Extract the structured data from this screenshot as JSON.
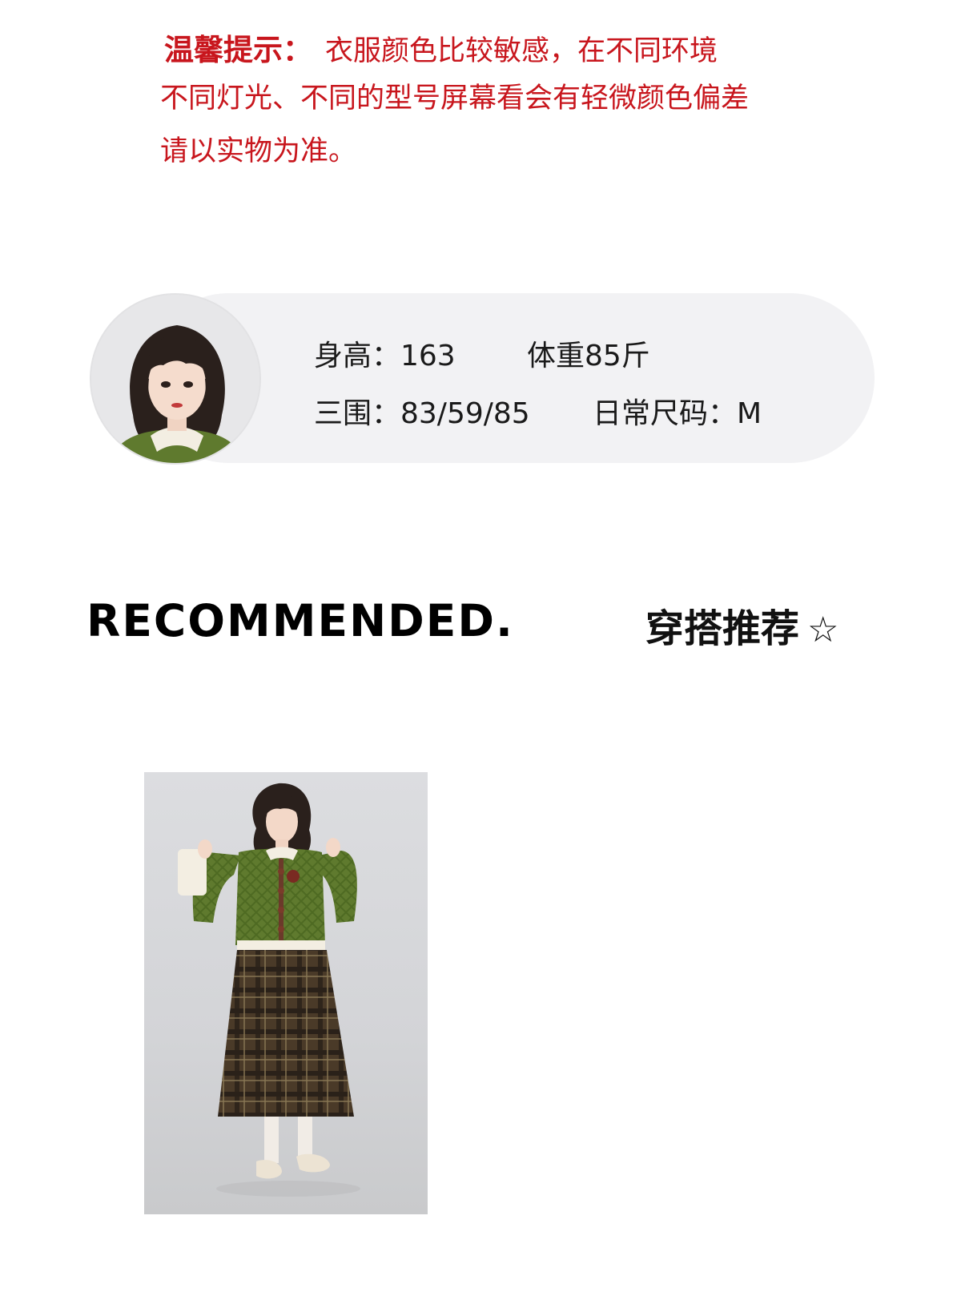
{
  "notice": {
    "label": "温馨提示：",
    "line1": "衣服颜色比较敏感，在不同环境",
    "line2": "不同灯光、不同的型号屏幕看会有轻微颜色偏差",
    "line3": "请以实物为准。"
  },
  "model": {
    "height": "身高：163",
    "weight": "体重85斤",
    "measurements": "三围：83/59/85",
    "size": "日常尺码：M"
  },
  "recommend": {
    "title_en": "RECOMMENDED.",
    "title_cn": "穿搭推荐",
    "star": "☆"
  },
  "colors": {
    "notice_red": "#c8161d",
    "card_bg": "#f2f2f4",
    "sweater_green": "#5f7a2e",
    "skirt_brown": "#4a3a28"
  }
}
